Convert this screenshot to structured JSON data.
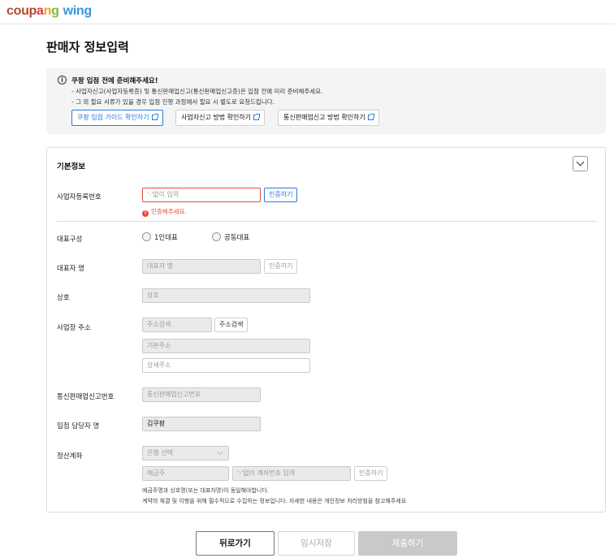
{
  "logo": {
    "part1": "coup",
    "part2": "a",
    "part3": "n",
    "part4": "g",
    "wing": "wing"
  },
  "page_title": "판매자 정보입력",
  "notice": {
    "title": "쿠팡 입점 전에 준비해주세요!",
    "line1": "- 사업자신고(사업자등록증) 및 통신판매업신고(통신판매업신고증)은 입점 전에 미리 준비해주세요.",
    "line2": "- 그 외 필요 서류가 있을 경우 입점 진행 과정에서 필요 시 별도로 요청드립니다.",
    "buttons": [
      "쿠팡 입점 가이드 확인하기",
      "사업자신고 방법 확인하기",
      "통신판매업신고 방법 확인하기"
    ]
  },
  "section": {
    "title": "기본정보",
    "biz_number": {
      "label": "사업자등록번호",
      "placeholder": "'-'없이 입력",
      "verify": "인증하기",
      "error": "인증해주세요."
    },
    "rep_type": {
      "label": "대표구성",
      "options": [
        "1인대표",
        "공동대표"
      ]
    },
    "rep_name": {
      "label": "대표자 명",
      "placeholder": "대표자 명",
      "verify": "인증하기"
    },
    "company": {
      "label": "상호",
      "placeholder": "상호"
    },
    "address": {
      "label": "사업장 주소",
      "search_placeholder": "주소검색",
      "search_button": "주소검색",
      "base_placeholder": "기본주소",
      "detail_placeholder": "상세주소"
    },
    "ecommerce": {
      "label": "통신판매업신고번호",
      "placeholder": "통신판매업신고번호"
    },
    "manager": {
      "label": "입점 담당자 명",
      "value": "김쿠팡"
    },
    "account": {
      "label": "정산계좌",
      "bank_select": "은행 선택",
      "holder_placeholder": "예금주",
      "number_placeholder": "'-'없이 계좌번호 입력",
      "verify": "인증하기",
      "hint1": "예금주명과 상호명(또는 대표자명)이 동일해야합니다.",
      "hint2": "계약의 체결 및 이행을 위해 필수적으로 수집하는 정보입니다. 자세한 내용은 개인정보 처리방침을 참고해주세요"
    }
  },
  "footer": {
    "back": "뒤로가기",
    "temp_save": "임시저장",
    "submit": "제출하기"
  }
}
